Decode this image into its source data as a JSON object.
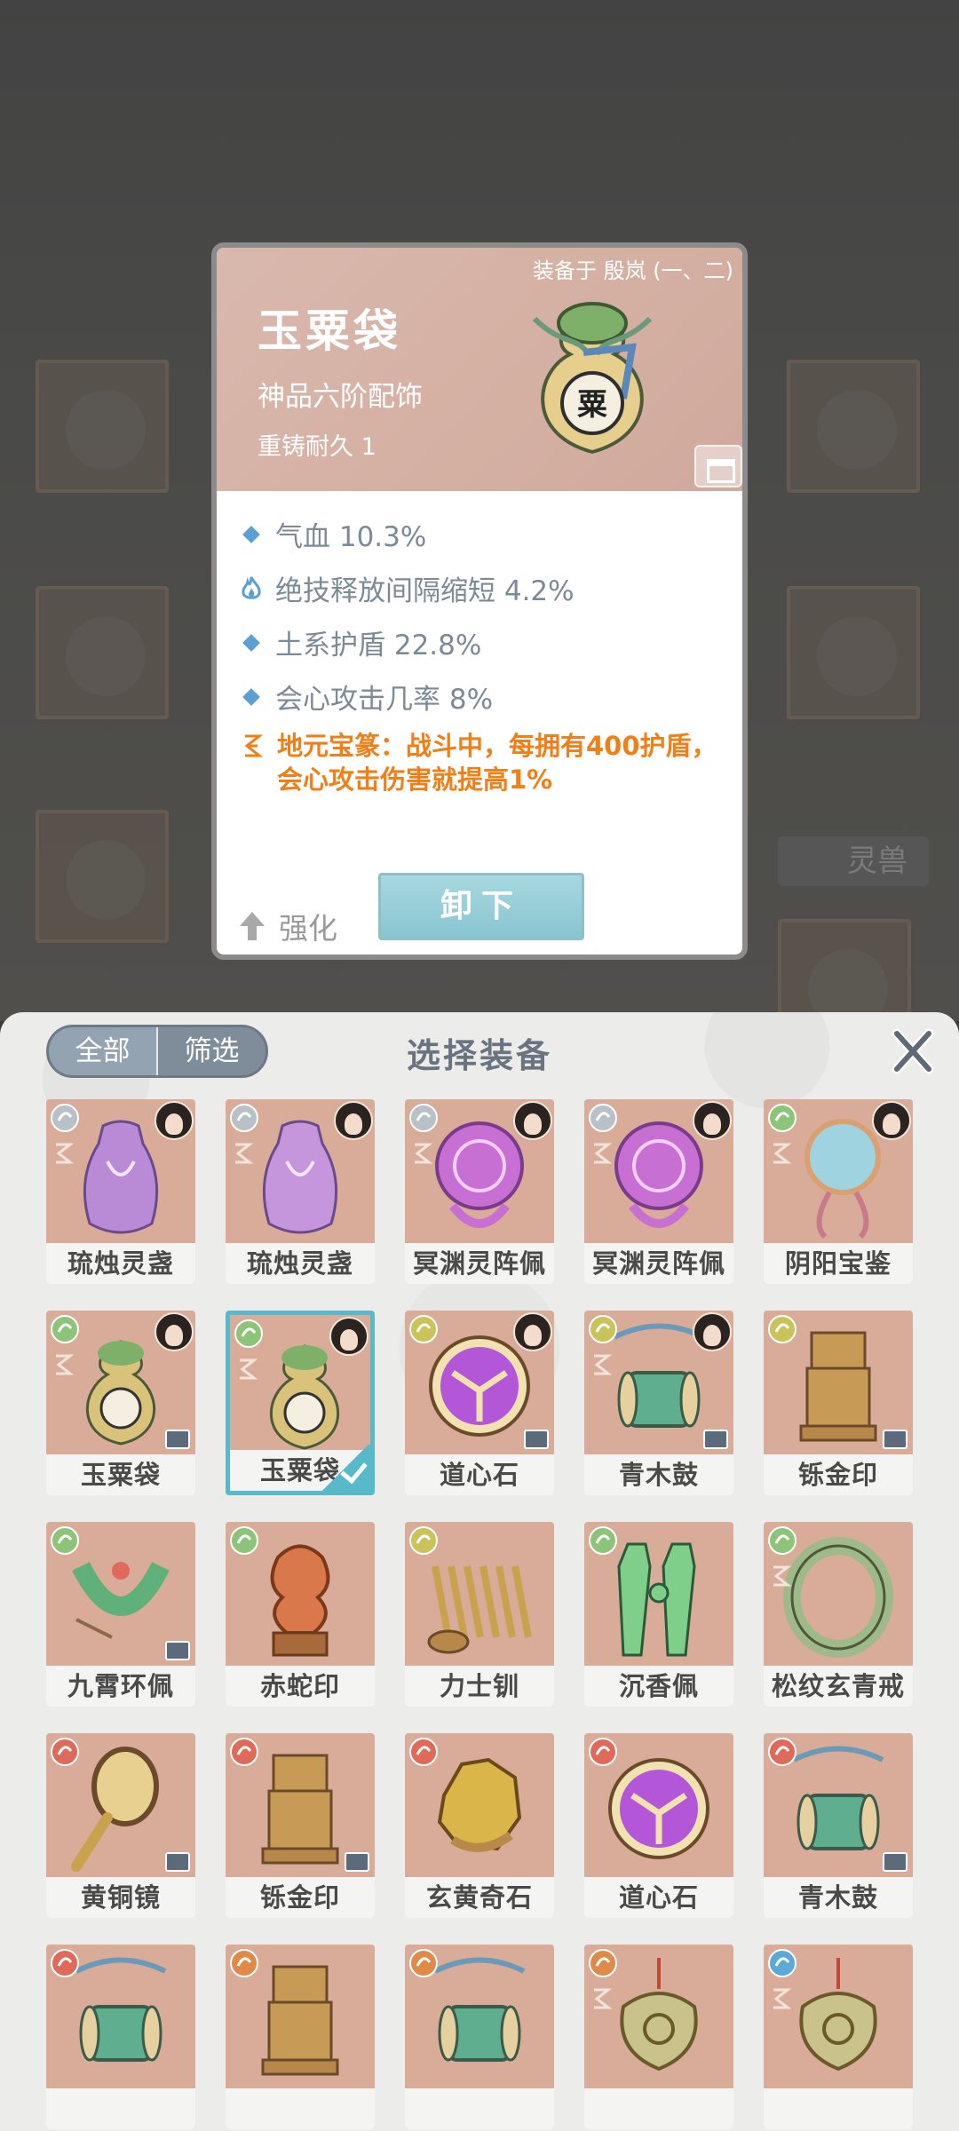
{
  "background": {
    "side_tab_label": "灵兽"
  },
  "detail": {
    "equipped_by": "装备于 殷岚 (一、二)",
    "name": "玉粟袋",
    "grade": "神品六阶配饰",
    "durability": "重铸耐久 1",
    "art_glyph": "粟",
    "stats": [
      {
        "icon": "diamond-icon",
        "text": "气血 10.3%"
      },
      {
        "icon": "flame-icon",
        "text": "绝技释放间隔缩短 4.2%"
      },
      {
        "icon": "diamond-icon",
        "text": "土系护盾 22.8%"
      },
      {
        "icon": "diamond-icon",
        "text": "会心攻击几率 8%"
      }
    ],
    "special": "地元宝篆：战斗中，每拥有400护盾，会心攻击伤害就提高1%",
    "enhance_label": "强化",
    "unequip_label": "卸下"
  },
  "panel": {
    "title": "选择装备",
    "filter_all": "全部",
    "filter_screen": "筛选",
    "items": [
      {
        "name": "琉烛灵盏",
        "elem": "#b9c0c8",
        "portrait": true,
        "rune": true,
        "art": "vase",
        "color": "#b98ad6"
      },
      {
        "name": "琉烛灵盏",
        "elem": "#b9c0c8",
        "portrait": true,
        "rune": true,
        "art": "vase",
        "color": "#c596dc"
      },
      {
        "name": "冥渊灵阵佩",
        "elem": "#b9c0c8",
        "portrait": true,
        "rune": true,
        "art": "orb",
        "color": "#c76fd3"
      },
      {
        "name": "冥渊灵阵佩",
        "elem": "#b9c0c8",
        "portrait": true,
        "rune": true,
        "art": "orb",
        "color": "#c76fd3"
      },
      {
        "name": "阴阳宝鉴",
        "elem": "#8cc47a",
        "portrait": true,
        "rune": true,
        "art": "mirror",
        "color": "#9fd3e0"
      },
      {
        "name": "玉粟袋",
        "elem": "#8cc47a",
        "portrait": true,
        "rune": true,
        "art": "bag",
        "color": "#d9c27a",
        "lock": true
      },
      {
        "name": "玉粟袋",
        "elem": "#8cc47a",
        "portrait": true,
        "rune": true,
        "art": "bag",
        "color": "#d9c27a",
        "selected": true
      },
      {
        "name": "道心石",
        "elem": "#c9c35a",
        "portrait": true,
        "rune": false,
        "art": "stone",
        "color": "#b357d8",
        "lock": true
      },
      {
        "name": "青木鼓",
        "elem": "#c9c35a",
        "portrait": true,
        "rune": true,
        "art": "drum",
        "color": "#5fae8f",
        "lock": true
      },
      {
        "name": "铄金印",
        "elem": "#c9c35a",
        "portrait": false,
        "rune": false,
        "art": "seal",
        "color": "#c79a55",
        "lock": true
      },
      {
        "name": "九霄环佩",
        "elem": "#8cc47a",
        "portrait": false,
        "rune": false,
        "art": "ring",
        "color": "#5fb07a",
        "lock": true
      },
      {
        "name": "赤蛇印",
        "elem": "#8cc47a",
        "portrait": false,
        "rune": false,
        "art": "snake",
        "color": "#d9784a"
      },
      {
        "name": "力士钏",
        "elem": "#c9c35a",
        "portrait": false,
        "rune": false,
        "art": "coil",
        "color": "#c9a24e"
      },
      {
        "name": "沉香佩",
        "elem": "#8cc47a",
        "portrait": false,
        "rune": false,
        "art": "jade",
        "color": "#7fcf8a"
      },
      {
        "name": "松纹玄青戒",
        "elem": "#8cc47a",
        "portrait": false,
        "rune": true,
        "art": "band",
        "color": "#9fb98a"
      },
      {
        "name": "黄铜镜",
        "elem": "#e06a5a",
        "portrait": false,
        "rune": false,
        "art": "handmirror",
        "color": "#c9a24e",
        "lock": true
      },
      {
        "name": "铄金印",
        "elem": "#e06a5a",
        "portrait": false,
        "rune": false,
        "art": "seal",
        "color": "#c79a55",
        "lock": true
      },
      {
        "name": "玄黄奇石",
        "elem": "#e06a5a",
        "portrait": false,
        "rune": false,
        "art": "rock",
        "color": "#d9b54a"
      },
      {
        "name": "道心石",
        "elem": "#e06a5a",
        "portrait": false,
        "rune": false,
        "art": "stone",
        "color": "#b357d8"
      },
      {
        "name": "青木鼓",
        "elem": "#e06a5a",
        "portrait": false,
        "rune": false,
        "art": "drum",
        "color": "#5fae8f",
        "lock": true
      },
      {
        "name": "",
        "elem": "#e06a5a",
        "portrait": false,
        "rune": false,
        "art": "drum",
        "color": "#5fae8f"
      },
      {
        "name": "",
        "elem": "#e08a4a",
        "portrait": false,
        "rune": false,
        "art": "seal",
        "color": "#c79a55"
      },
      {
        "name": "",
        "elem": "#e08a4a",
        "portrait": false,
        "rune": false,
        "art": "drum",
        "color": "#5fae8f"
      },
      {
        "name": "",
        "elem": "#e08a4a",
        "portrait": false,
        "rune": true,
        "art": "pendant",
        "color": "#c9c28a"
      },
      {
        "name": "",
        "elem": "#5aa9d9",
        "portrait": false,
        "rune": true,
        "art": "pendant",
        "color": "#c9c28a"
      }
    ]
  }
}
